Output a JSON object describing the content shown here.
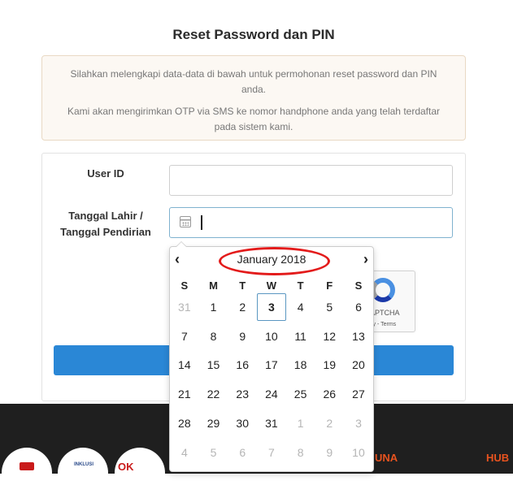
{
  "page": {
    "title": "Reset Password dan PIN"
  },
  "info": {
    "paragraph1": "Silahkan melengkapi data-data di bawah untuk permohonan reset password dan PIN anda.",
    "paragraph2": "Kami akan mengirimkan OTP via SMS ke nomor handphone anda yang telah terdaftar pada sistem kami."
  },
  "form": {
    "user_id_label": "User ID",
    "user_id_value": "",
    "date_label_line1": "Tanggal Lahir /",
    "date_label_line2": "Tanggal Pendirian",
    "date_value": "",
    "submit_label": ""
  },
  "captcha": {
    "label": "APTCHA",
    "links": "cy - Terms"
  },
  "datepicker": {
    "prev_icon": "chevron-left-icon",
    "next_icon": "chevron-right-icon",
    "month_label": "January 2018",
    "weekdays": [
      "S",
      "M",
      "T",
      "W",
      "T",
      "F",
      "S"
    ],
    "weeks": [
      [
        {
          "d": "31",
          "m": true
        },
        {
          "d": "1"
        },
        {
          "d": "2"
        },
        {
          "d": "3",
          "today": true
        },
        {
          "d": "4"
        },
        {
          "d": "5"
        },
        {
          "d": "6"
        }
      ],
      [
        {
          "d": "7"
        },
        {
          "d": "8"
        },
        {
          "d": "9"
        },
        {
          "d": "10"
        },
        {
          "d": "11"
        },
        {
          "d": "12"
        },
        {
          "d": "13"
        }
      ],
      [
        {
          "d": "14"
        },
        {
          "d": "15"
        },
        {
          "d": "16"
        },
        {
          "d": "17"
        },
        {
          "d": "18"
        },
        {
          "d": "19"
        },
        {
          "d": "20"
        }
      ],
      [
        {
          "d": "21"
        },
        {
          "d": "22"
        },
        {
          "d": "23"
        },
        {
          "d": "24"
        },
        {
          "d": "25"
        },
        {
          "d": "26"
        },
        {
          "d": "27"
        }
      ],
      [
        {
          "d": "28"
        },
        {
          "d": "29"
        },
        {
          "d": "30"
        },
        {
          "d": "31"
        },
        {
          "d": "1",
          "m": true
        },
        {
          "d": "2",
          "m": true
        },
        {
          "d": "3",
          "m": true
        }
      ],
      [
        {
          "d": "4",
          "m": true
        },
        {
          "d": "5",
          "m": true
        },
        {
          "d": "6",
          "m": true
        },
        {
          "d": "7",
          "m": true
        },
        {
          "d": "8",
          "m": true
        },
        {
          "d": "9",
          "m": true
        },
        {
          "d": "10",
          "m": true
        }
      ]
    ]
  },
  "footer": {
    "heading_partial": "UNA",
    "heading_right": "HUB",
    "logo2_text": "INKLUSI",
    "logo3_text": "OK"
  },
  "colors": {
    "accent": "#2a87d6",
    "annotation": "#e31b1b",
    "footer_bg": "#1f1f1f",
    "footer_heading": "#e8531f"
  }
}
